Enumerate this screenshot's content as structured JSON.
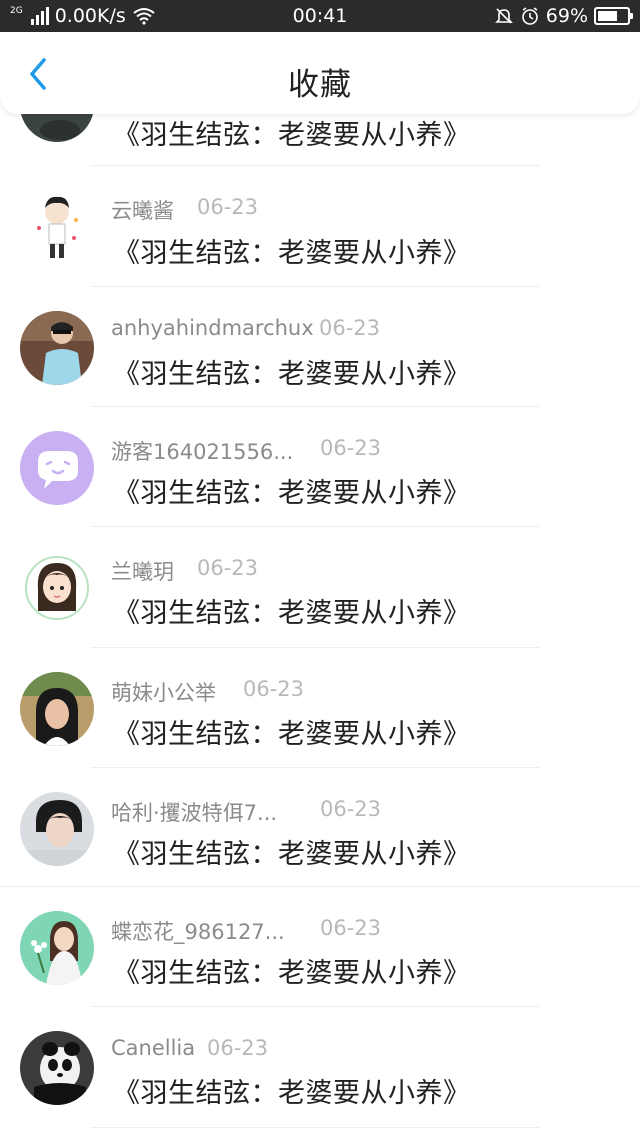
{
  "status_bar": {
    "network_type": "2G",
    "speed": "0.00K/s",
    "time": "00:41",
    "battery": "69%",
    "battery_level": 0.69,
    "icons": [
      "signal-icon",
      "wifi-icon",
      "mute-bell-icon",
      "alarm-icon",
      "battery-icon"
    ]
  },
  "header": {
    "title": "收藏",
    "back_icon": "chevron-left-icon",
    "accent_color": "#1e9be8"
  },
  "items": [
    {
      "username": "",
      "date": "",
      "title": "《羽生结弦：老婆要从小养》",
      "avatar": "avatar-photo-dark"
    },
    {
      "username": "云曦酱",
      "date": "06-23",
      "title": "《羽生结弦：老婆要从小养》",
      "avatar": "avatar-cartoon-boy"
    },
    {
      "username": "anhyahindmarchux",
      "date": "06-23",
      "title": "《羽生结弦：老婆要从小养》",
      "avatar": "avatar-photo-person"
    },
    {
      "username": "游客164021556...",
      "date": "06-23",
      "title": "《羽生结弦：老婆要从小养》",
      "avatar": "avatar-guest-chat-bubble"
    },
    {
      "username": "兰曦玥",
      "date": "06-23",
      "title": "《羽生结弦：老婆要从小养》",
      "avatar": "avatar-cartoon-girl"
    },
    {
      "username": "萌妹小公举",
      "date": "06-23",
      "title": "《羽生结弦：老婆要从小养》",
      "avatar": "avatar-photo-girl"
    },
    {
      "username": "哈利·攫波特佴7...",
      "date": "06-23",
      "title": "《羽生结弦：老婆要从小养》",
      "avatar": "avatar-photo-boy"
    },
    {
      "username": "蝶恋花_986127...",
      "date": "06-23",
      "title": "《羽生结弦：老婆要从小养》",
      "avatar": "avatar-photo-bride"
    },
    {
      "username": "Canellia",
      "date": "06-23",
      "title": "《羽生结弦：老婆要从小养》",
      "avatar": "avatar-panda"
    }
  ]
}
